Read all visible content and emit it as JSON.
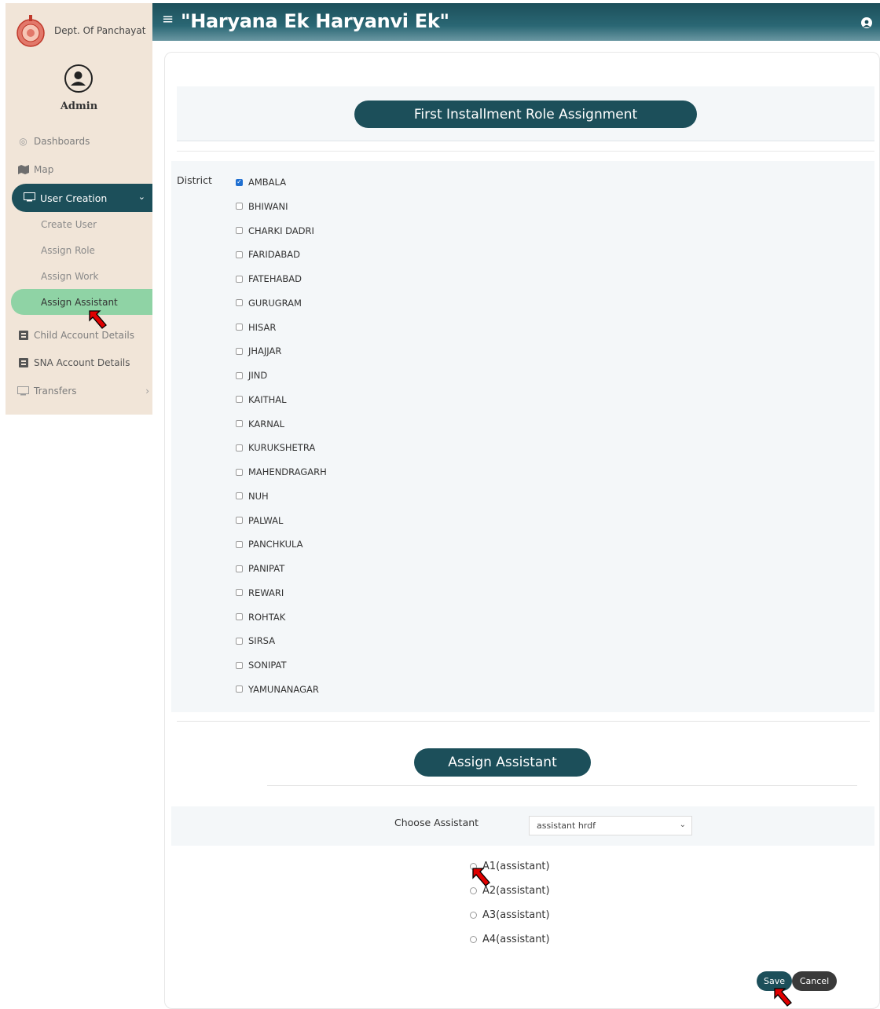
{
  "sidebar": {
    "brand": "Dept. Of Panchayat",
    "user_role": "Admin",
    "items": [
      {
        "label": "Dashboards",
        "icon": "dashboard-icon"
      },
      {
        "label": "Map",
        "icon": "map-icon"
      },
      {
        "label": "User Creation",
        "icon": "user-creation-icon",
        "expanded": true
      },
      {
        "label": "Child Account Details",
        "icon": "id-card-icon"
      },
      {
        "label": "SNA Account Details",
        "icon": "id-card-icon"
      },
      {
        "label": "Transfers",
        "icon": "transfer-icon"
      }
    ],
    "sub_items": [
      "Create User",
      "Assign Role",
      "Assign Work",
      "Assign Assistant"
    ],
    "active_sub_item": "Assign Assistant"
  },
  "header": {
    "title": "\"Haryana Ek Haryanvi Ek\""
  },
  "main": {
    "section1_title": "First Installment Role Assignment",
    "district_label": "District",
    "districts": [
      {
        "name": "AMBALA",
        "checked": true
      },
      {
        "name": "BHIWANI",
        "checked": false
      },
      {
        "name": "CHARKI DADRI",
        "checked": false
      },
      {
        "name": "FARIDABAD",
        "checked": false
      },
      {
        "name": "FATEHABAD",
        "checked": false
      },
      {
        "name": "GURUGRAM",
        "checked": false
      },
      {
        "name": "HISAR",
        "checked": false
      },
      {
        "name": "JHAJJAR",
        "checked": false
      },
      {
        "name": "JIND",
        "checked": false
      },
      {
        "name": "KAITHAL",
        "checked": false
      },
      {
        "name": "KARNAL",
        "checked": false
      },
      {
        "name": "KURUKSHETRA",
        "checked": false
      },
      {
        "name": "MAHENDRAGARH",
        "checked": false
      },
      {
        "name": "NUH",
        "checked": false
      },
      {
        "name": "PALWAL",
        "checked": false
      },
      {
        "name": "PANCHKULA",
        "checked": false
      },
      {
        "name": "PANIPAT",
        "checked": false
      },
      {
        "name": "REWARI",
        "checked": false
      },
      {
        "name": "ROHTAK",
        "checked": false
      },
      {
        "name": "SIRSA",
        "checked": false
      },
      {
        "name": "SONIPAT",
        "checked": false
      },
      {
        "name": "YAMUNANAGAR",
        "checked": false
      }
    ],
    "section2_title": "Assign Assistant",
    "choose_assistant_label": "Choose Assistant",
    "choose_assistant_value": "assistant hrdf",
    "assistant_options": [
      "A1(assistant)",
      "A2(assistant)",
      "A3(assistant)",
      "A4(assistant)"
    ],
    "save_label": "Save",
    "cancel_label": "Cancel"
  },
  "colors": {
    "primary": "#1c4f5a",
    "sidebar_bg": "#f1e5d8",
    "active_item": "#8fd3a5",
    "checkbox_checked": "#1f6fd1",
    "annotation_arrow": "#e00000"
  }
}
